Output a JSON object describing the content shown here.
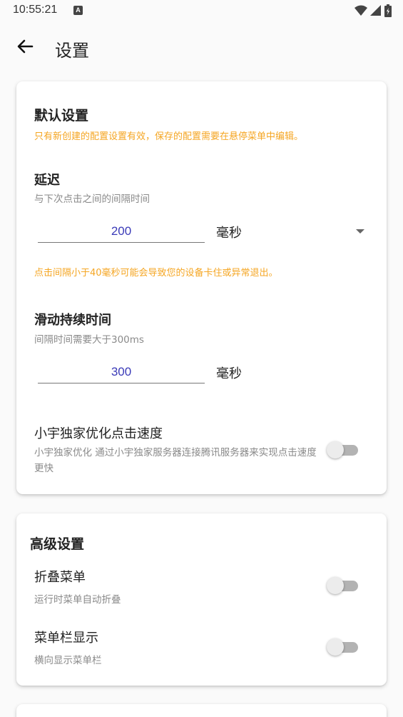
{
  "status": {
    "time": "10:55:21",
    "notif_letter": "A",
    "icons": [
      "wifi-icon",
      "signal-icon",
      "battery-icon"
    ]
  },
  "header": {
    "title": "设置",
    "back_icon": "arrow-left-icon"
  },
  "default_settings": {
    "title": "默认设置",
    "notice": "只有新创建的配置设置有效，保存的配置需要在悬停菜单中编辑。",
    "delay": {
      "title": "延迟",
      "subtitle": "与下次点击之间的间隔时间",
      "value": "200",
      "unit": "毫秒",
      "warning": "点击间隔小于40毫秒可能会导致您的设备卡住或异常退出。"
    },
    "swipe": {
      "title": "滑动持续时间",
      "subtitle": "间隔时间需要大于300ms",
      "value": "300",
      "unit": "毫秒"
    },
    "optimize": {
      "title": "小宇独家优化点击速度",
      "subtitle": "小宇独家优化  通过小宇独家服务器连接腾讯服务器来实现点击速度更快",
      "enabled": false
    }
  },
  "advanced_settings": {
    "title": "高级设置",
    "collapse_menu": {
      "title": "折叠菜单",
      "subtitle": "运行时菜单自动折叠",
      "enabled": false
    },
    "menu_bar": {
      "title": "菜单栏显示",
      "subtitle": "横向显示菜单栏",
      "enabled": false
    }
  },
  "colors": {
    "accent_text": "#3b3bb8",
    "warning": "#f5a623",
    "switch_off_track": "#b3b3b3"
  }
}
